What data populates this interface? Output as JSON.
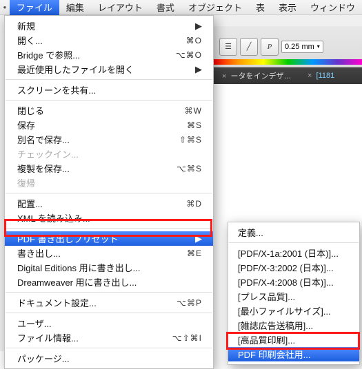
{
  "menubar": {
    "items": [
      "ファイル",
      "編集",
      "レイアウト",
      "書式",
      "オブジェクト",
      "表",
      "表示",
      "ウィンドウ"
    ],
    "active_index": 0
  },
  "toolbar": {
    "stroke_value": "0.25 mm"
  },
  "tabs": {
    "a": "ータをインデザインC...",
    "b": "[1181"
  },
  "file_menu": {
    "new": "新規",
    "open": "開く...",
    "open_sc": "⌘O",
    "bridge": "Bridge で参照...",
    "bridge_sc": "⌥⌘O",
    "recent": "最近使用したファイルを開く",
    "share_screen": "スクリーンを共有...",
    "close": "閉じる",
    "close_sc": "⌘W",
    "save": "保存",
    "save_sc": "⌘S",
    "save_as": "別名で保存...",
    "save_as_sc": "⇧⌘S",
    "checkin": "チェックイン...",
    "save_copy": "複製を保存...",
    "save_copy_sc": "⌥⌘S",
    "revert": "復帰",
    "place": "配置...",
    "place_sc": "⌘D",
    "import_xml": "XML を読み込み...",
    "pdf_presets": "PDF 書き出しプリセット",
    "export": "書き出し...",
    "export_sc": "⌘E",
    "digital_editions": "Digital Editions 用に書き出し...",
    "dreamweaver": "Dreamweaver 用に書き出し...",
    "doc_setup": "ドキュメント設定...",
    "doc_setup_sc": "⌥⌘P",
    "user": "ユーザ...",
    "file_info": "ファイル情報...",
    "file_info_sc": "⌥⇧⌘I",
    "package": "パッケージ..."
  },
  "pdf_presets_submenu": {
    "define": "定義...",
    "x1a": "[PDF/X-1a:2001 (日本)]...",
    "x3": "[PDF/X-3:2002 (日本)]...",
    "x4": "[PDF/X-4:2008 (日本)]...",
    "press": "[プレス品質]...",
    "small": "[最小ファイルサイズ]...",
    "magazine": "[雑誌広告送稿用]...",
    "highq": "[高品質印刷]...",
    "printer": "PDF 印刷会社用..."
  }
}
